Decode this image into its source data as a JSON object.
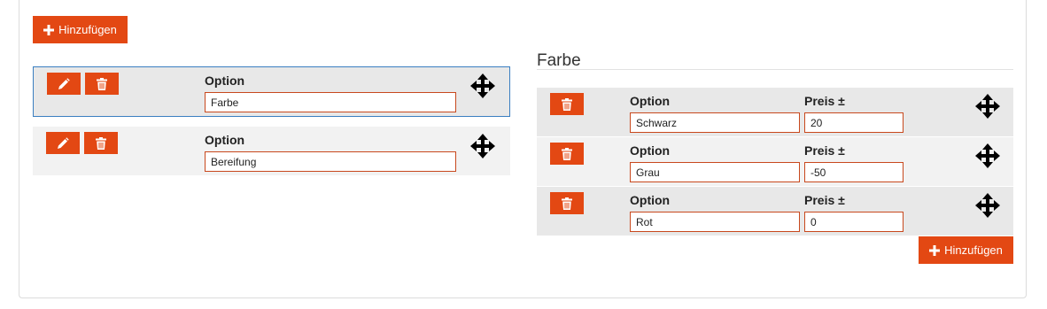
{
  "add_button": {
    "label": "Hinzufügen",
    "icon": "plus-icon"
  },
  "groups": [
    {
      "option_label": "Option",
      "value": "Farbe",
      "selected": true
    },
    {
      "option_label": "Option",
      "value": "Bereifung",
      "selected": false
    }
  ],
  "detail": {
    "title": "Farbe",
    "rows": [
      {
        "option_label": "Option",
        "price_label": "Preis ±",
        "option_value": "Schwarz",
        "price_value": "20"
      },
      {
        "option_label": "Option",
        "price_label": "Preis ±",
        "option_value": "Grau",
        "price_value": "-50"
      },
      {
        "option_label": "Option",
        "price_label": "Preis ±",
        "option_value": "Rot",
        "price_value": "0"
      }
    ],
    "add_label": "Hinzufügen"
  },
  "colors": {
    "accent": "#e34813",
    "row_even": "#e8e8e8",
    "row_odd": "#f2f2f2",
    "selected_border": "#3a7fc1"
  }
}
